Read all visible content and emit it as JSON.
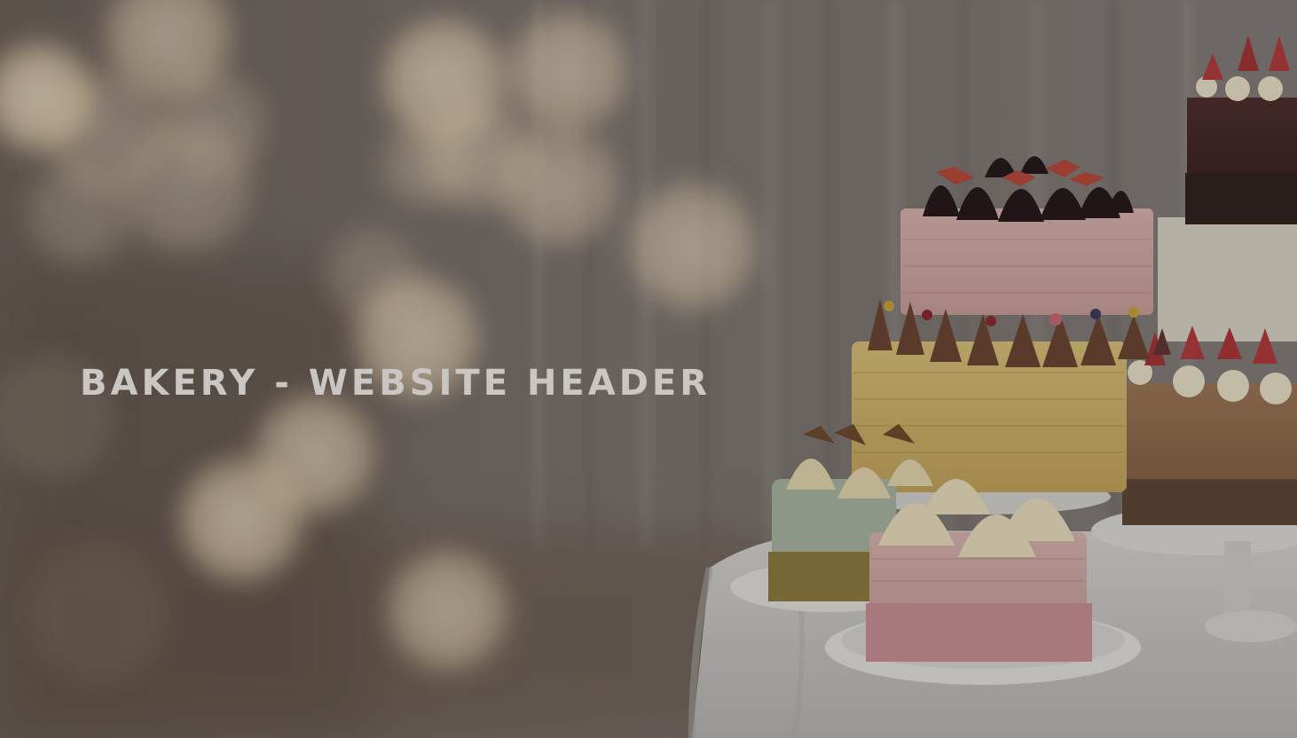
{
  "header": {
    "title": "BAKERY - WEBSITE HEADER"
  },
  "colors": {
    "overlay": "#3a3431",
    "title_text": "#c9c6c3",
    "bokeh_light": "#f3e3c6",
    "curtain": "#7d7673",
    "tablecloth": "#c9c7c6"
  },
  "image": {
    "subject": "cakes-display",
    "background": "bokeh-lights"
  }
}
